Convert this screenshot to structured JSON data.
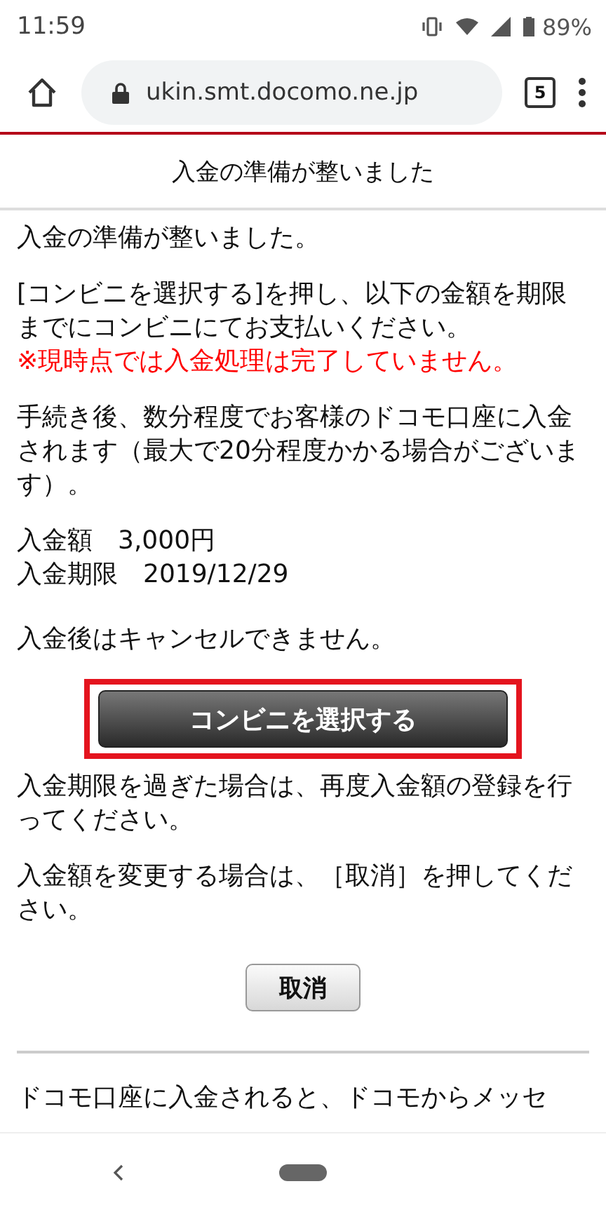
{
  "status_bar": {
    "time": "11:59",
    "battery": "89%"
  },
  "browser": {
    "url": "ukin.smt.docomo.ne.jp",
    "tab_count": "5"
  },
  "page_title": "入金の準備が整いました",
  "intro": "入金の準備が整いました。",
  "instruction": "[コンビニを選択する]を押し、以下の金額を期限までにコンビニにてお支払いください。",
  "warning": "※現時点では入金処理は完了していません。",
  "note": "手続き後、数分程度でお客様のドコモ口座に入金されます（最大で20分程度かかる場合がございます）。",
  "details": [
    {
      "label": "入金額",
      "value": "3,000円"
    },
    {
      "label": "入金期限",
      "value": "2019/12/29"
    }
  ],
  "cancel_note": "入金後はキャンセルできません。",
  "primary_button": "コンビニを選択する",
  "expired_note": "入金期限を過ぎた場合は、再度入金額の登録を行ってください。",
  "change_note": "入金額を変更する場合は、［取消］を押してください。",
  "cancel_button": "取消",
  "footer_text": "ドコモ口座に入金されると、ドコモからメッセ"
}
